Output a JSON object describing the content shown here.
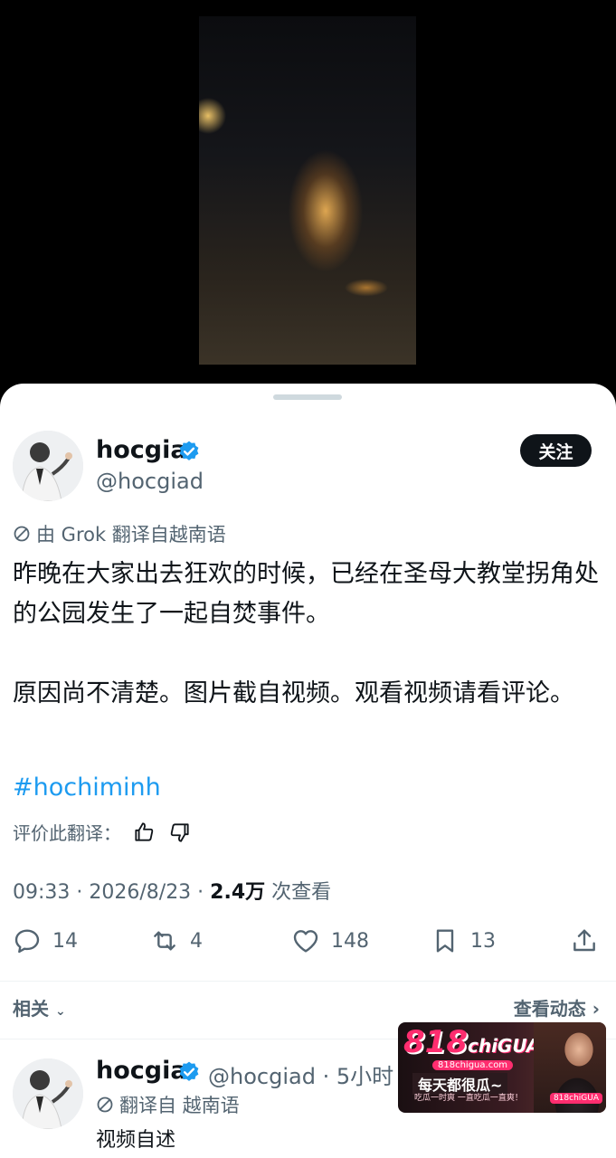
{
  "colors": {
    "link": "#1d9bf0",
    "verified": "#1d9bf0",
    "text": "#0f1419",
    "secondary": "#536471"
  },
  "tweet": {
    "display_name": "hocgia",
    "handle": "@hocgiad",
    "follow_label": "关注",
    "translated_by": "由 Grok 翻译自越南语",
    "text_p1": "昨晚在大家出去狂欢的时候，已经在圣母大教堂拐角处的公园发生了一起自焚事件。",
    "text_p2": "原因尚不清楚。图片截自视频。观看视频请看评论。",
    "hashtag": "#hochiminh",
    "rate_label": "评价此翻译：",
    "time_date": "09:33 · 2026/8/23 · ",
    "views_count": "2.4万",
    "views_label": " 次查看",
    "replies": "14",
    "retweets": "4",
    "likes": "148",
    "bookmarks": "13",
    "icons": [
      "verified-badge-icon",
      "reply-icon",
      "retweet-icon",
      "like-icon",
      "bookmark-icon",
      "share-icon",
      "thumbs-up-icon",
      "thumbs-down-icon",
      "translate-icon",
      "chevron-down-icon",
      "chevron-right-icon"
    ]
  },
  "related": {
    "label": "相关",
    "activity_label": "查看动态"
  },
  "reply": {
    "display_name": "hocgia",
    "handle_time": "@hocgiad · 5小时",
    "translated_by": "翻译自 越南语",
    "text": "视频自述"
  },
  "ad": {
    "logo_num": "818",
    "logo_word": "chiGUA",
    "url": "818chigua.com",
    "slogan": "每天都很瓜~",
    "sub": "吃瓜一时爽 一直吃瓜一直爽！",
    "badge": "818chiGUA"
  }
}
